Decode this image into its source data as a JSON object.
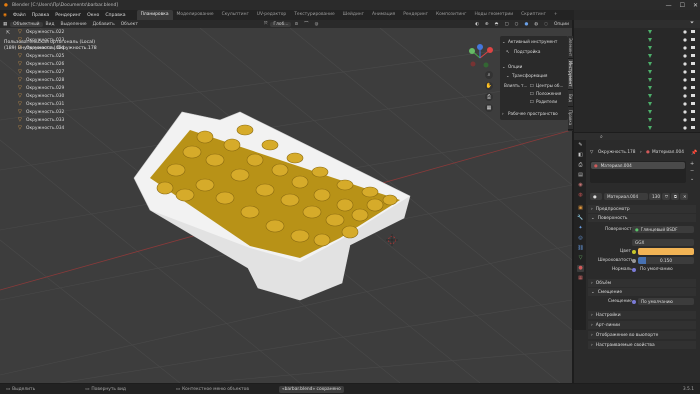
{
  "window": {
    "title": "Blender [C:\\Users\\Пр\\Documents\\barbar.blend]"
  },
  "menu": [
    "Файл",
    "Правка",
    "Рендеринг",
    "Окно",
    "Справка"
  ],
  "workspaces": [
    "Планировка",
    "Моделирование",
    "Скульптинг",
    "UV-редактор",
    "Текстурирование",
    "Шейдинг",
    "Анимация",
    "Рендеринг",
    "Композитинг",
    "Ноды геометрии",
    "Скриптинг"
  ],
  "active_workspace": "Планировка",
  "scene": {
    "label": "Scene",
    "view_layer": "ViewLayer"
  },
  "viewport_header": {
    "mode": "Объектный",
    "view": "Вид",
    "select": "Выделение",
    "add": "Добавить",
    "object": "Объект",
    "orientation": "Глоб...",
    "options": "Опции"
  },
  "viewport_info": {
    "line1": "Пользовательская ортогональ (Local)",
    "line2": "(189) Внутренности | Окружность.178"
  },
  "npanel": {
    "active_tool": "Активный инструмент",
    "tweak": "Подстройка",
    "options": "Опции",
    "transform": "Трансформация",
    "affect_only": "Влиять т...",
    "origins": "Центры об...",
    "locations": "Положения",
    "parents": "Родители",
    "workspace": "Рабочее пространство",
    "tabs": [
      "Элемент",
      "Инструмент",
      "Вид",
      "Правка"
    ]
  },
  "outliner": {
    "items": [
      "Окружность.022",
      "Окружность.023",
      "Окружность.024",
      "Окружность.025",
      "Окружность.026",
      "Окружность.027",
      "Окружность.028",
      "Окружность.029",
      "Окружность.030",
      "Окружность.031",
      "Окружность.032",
      "Окружность.033",
      "Окружность.034",
      "Окружность.035"
    ]
  },
  "properties": {
    "object_name": "Окружность.178",
    "material_slot": "Материал.004",
    "material_breadcrumb": "Материал.004",
    "material_name": "Материал.004",
    "users": "130",
    "preview": "Предпросмотр",
    "surface_section": "Поверхность",
    "surface_label": "Поверхность",
    "surface_value": "Глянцевый BSDF",
    "distribution": "GGX",
    "color_label": "Цвет",
    "color_value": "#f2b455",
    "roughness_label": "Шероховатость",
    "roughness_value": "0.150",
    "normal_label": "Нормаль",
    "normal_value": "По умолчанию",
    "volume": "Объём",
    "displacement_section": "Смещение",
    "displacement_label": "Смещение",
    "displacement_value": "По умолчанию",
    "settings": "Настройки",
    "lineart": "Арт-линии",
    "viewport_display": "Отображение во вьюпорте",
    "custom_props": "Настраиваемые свойства"
  },
  "statusbar": {
    "select": "Выделить",
    "rotate": "Повернуть вид",
    "context": "Контекстное меню объектов",
    "saved": "«barbar.blend» сохранено",
    "version": "3.5.1"
  }
}
